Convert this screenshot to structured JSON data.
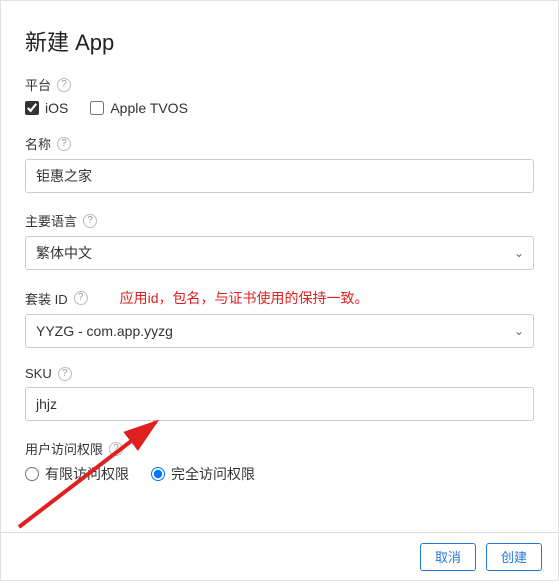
{
  "title": "新建 App",
  "fields": {
    "platform": {
      "label": "平台"
    },
    "ios": {
      "label": "iOS",
      "checked": true
    },
    "tvos": {
      "label": "Apple TVOS",
      "checked": false
    },
    "name": {
      "label": "名称",
      "value": "钜惠之家"
    },
    "language": {
      "label": "主要语言",
      "value": "繁体中文"
    },
    "bundle": {
      "label": "套装 ID",
      "annotation": "应用id，包名，与证书使用的保持一致。",
      "value": "YYZG - com.app.yyzg"
    },
    "sku": {
      "label": "SKU",
      "value": "jhjz"
    },
    "access": {
      "label": "用户访问权限"
    },
    "limited": {
      "label": "有限访问权限"
    },
    "full": {
      "label": "完全访问权限"
    }
  },
  "buttons": {
    "cancel": "取消",
    "create": "创建"
  },
  "help_glyph": "?"
}
